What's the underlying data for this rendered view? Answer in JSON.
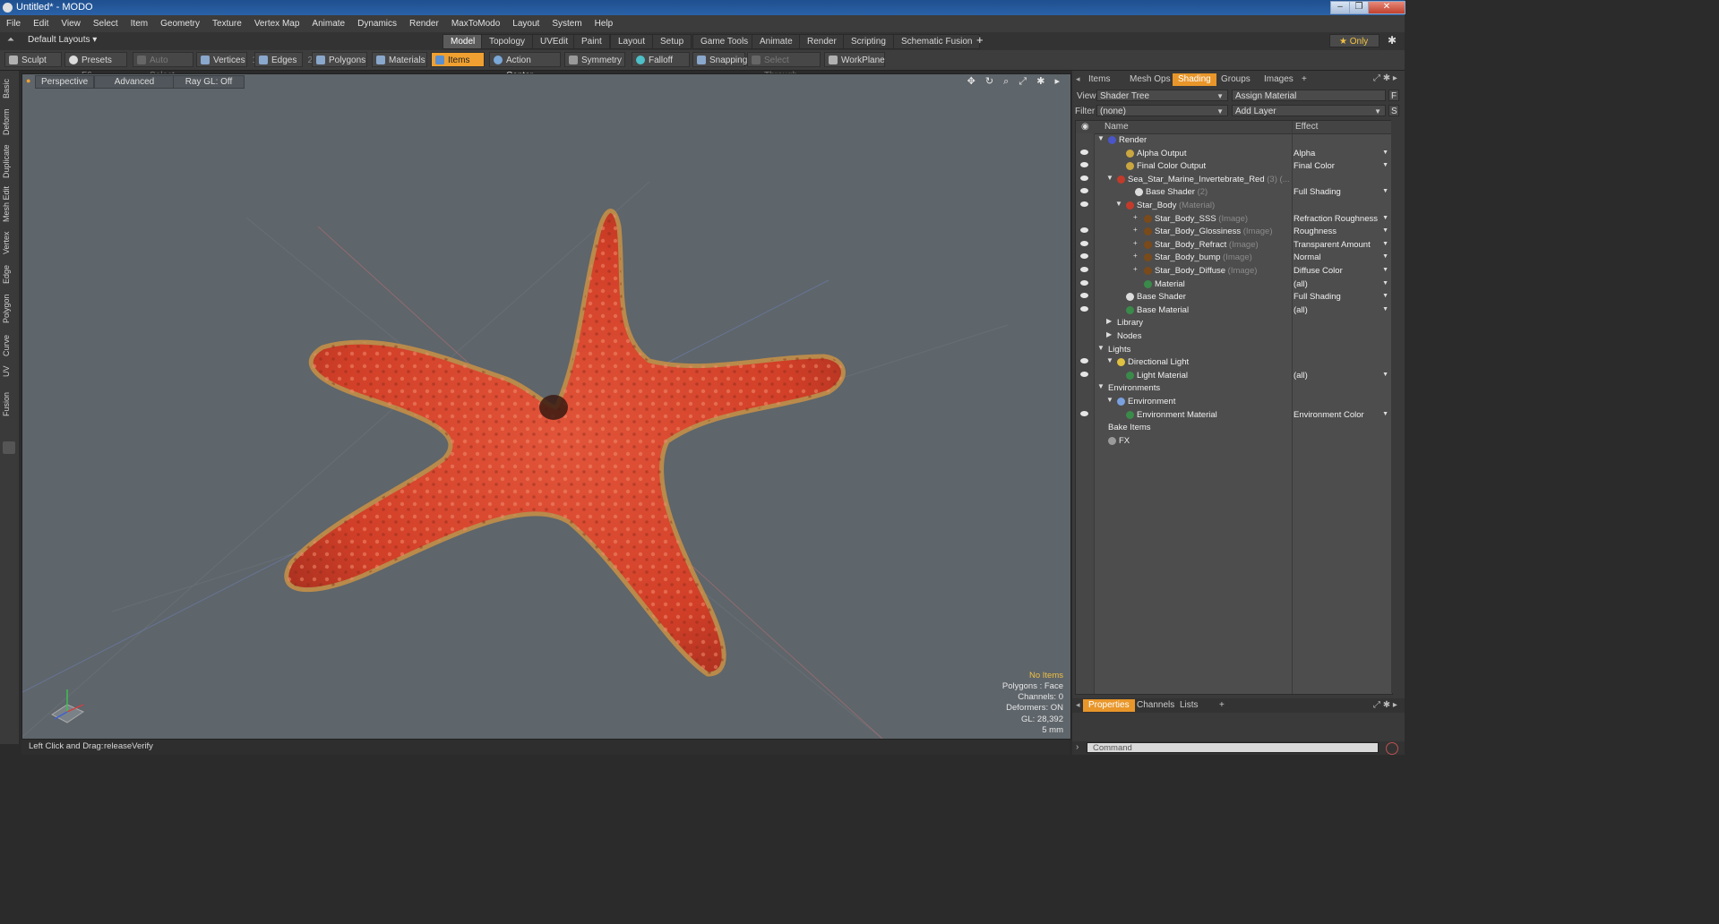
{
  "window": {
    "title": "Untitled* - MODO",
    "minimize": "–",
    "restore": "❐",
    "close": "✕"
  },
  "menu": [
    "File",
    "Edit",
    "View",
    "Select",
    "Item",
    "Geometry",
    "Texture",
    "Vertex Map",
    "Animate",
    "Dynamics",
    "Render",
    "MaxToModo",
    "Layout",
    "System",
    "Help"
  ],
  "layout": {
    "preset": "Default Layouts ▾",
    "tabs": [
      "Model",
      "Topology",
      "UVEdit",
      "Paint",
      "Layout",
      "Setup",
      "Game Tools",
      "Animate",
      "Render",
      "Scripting",
      "Schematic Fusion"
    ],
    "active_tab": "Model",
    "add": "+",
    "only": "★  Only",
    "gear": "✱"
  },
  "toolbar": {
    "sculpt": "Sculpt",
    "presets": "Presets",
    "presets_key": "F6",
    "auto_select": "Auto Select",
    "vertices": "Vertices",
    "vertices_count": "1",
    "edges": "Edges",
    "edges_count": "2",
    "polygons": "Polygons",
    "materials": "Materials",
    "items": "Items",
    "action_center": "Action Center",
    "symmetry": "Symmetry",
    "falloff": "Falloff",
    "snapping": "Snapping",
    "select_through": "Select Through",
    "workplane": "WorkPlane"
  },
  "left_tabs": [
    "Basic",
    "Deform",
    "Duplicate",
    "Mesh Edit",
    "Vertex",
    "Edge",
    "Polygon",
    "Curve",
    "UV",
    "Fusion"
  ],
  "viewport": {
    "perspective": "Perspective",
    "advanced": "Advanced",
    "raygl": "Ray GL: Off",
    "icons": "✥ ↻ ⌕ ⤢ ✱ ▸",
    "stats": {
      "selection": "No Items",
      "polygons": "Polygons : Face",
      "channels": "Channels: 0",
      "deformers": "Deformers: ON",
      "gl": "GL: 28,392",
      "scale": "5 mm"
    }
  },
  "status": {
    "hint": "Left Click and Drag:",
    "action": "releaseVerify"
  },
  "right_panel": {
    "tabs": [
      "Items",
      "Mesh Ops",
      "Shading",
      "Groups",
      "Images"
    ],
    "active_tab": "Shading",
    "add": "+",
    "view_label": "View",
    "view_value": "Shader Tree",
    "assign_material": "Assign Material",
    "f_btn": "F",
    "filter_label": "Filter",
    "filter_value": "(none)",
    "add_layer": "Add Layer",
    "s_btn": "S",
    "col_name": "Name",
    "col_effect": "Effect",
    "tree": [
      {
        "name": "Render",
        "sub": "",
        "effect": "",
        "indent": 0,
        "exp": "▼",
        "eye": false,
        "color": "#4a55c8"
      },
      {
        "name": "Alpha Output",
        "sub": "",
        "effect": "Alpha",
        "indent": 2,
        "exp": "",
        "eye": true,
        "color": "#c9a640"
      },
      {
        "name": "Final Color Output",
        "sub": "",
        "effect": "Final Color",
        "indent": 2,
        "exp": "",
        "eye": true,
        "color": "#c9a640"
      },
      {
        "name": "Sea_Star_Marine_Invertebrate_Red",
        "sub": " (3) (...",
        "effect": "",
        "indent": 1,
        "exp": "▼",
        "eye": true,
        "color": "#c23b2a"
      },
      {
        "name": "Base Shader",
        "sub": " (2)",
        "effect": "Full Shading",
        "indent": 3,
        "exp": "",
        "eye": true,
        "color": "#dcdcdc"
      },
      {
        "name": "Star_Body",
        "sub": " (Material)",
        "effect": "",
        "indent": 2,
        "exp": "▼",
        "eye": true,
        "color": "#c23b2a"
      },
      {
        "name": "Star_Body_SSS",
        "sub": " (Image)",
        "effect": "Refraction Roughness",
        "indent": 4,
        "exp": "+",
        "eye": false,
        "color": "#7a4a1a"
      },
      {
        "name": "Star_Body_Glossiness",
        "sub": " (Image)",
        "effect": "Roughness",
        "indent": 4,
        "exp": "+",
        "eye": true,
        "color": "#7a4a1a"
      },
      {
        "name": "Star_Body_Refract",
        "sub": " (Image)",
        "effect": "Transparent Amount",
        "indent": 4,
        "exp": "+",
        "eye": true,
        "color": "#7a4a1a"
      },
      {
        "name": "Star_Body_bump",
        "sub": " (Image)",
        "effect": "Normal",
        "indent": 4,
        "exp": "+",
        "eye": true,
        "color": "#7a4a1a"
      },
      {
        "name": "Star_Body_Diffuse",
        "sub": " (Image)",
        "effect": "Diffuse Color",
        "indent": 4,
        "exp": "+",
        "eye": true,
        "color": "#7a4a1a"
      },
      {
        "name": "Material",
        "sub": "",
        "effect": "(all)",
        "indent": 4,
        "exp": "",
        "eye": true,
        "color": "#3a8a4a"
      },
      {
        "name": "Base Shader",
        "sub": "",
        "effect": "Full Shading",
        "indent": 2,
        "exp": "",
        "eye": true,
        "color": "#dcdcdc"
      },
      {
        "name": "Base Material",
        "sub": "",
        "effect": "(all)",
        "indent": 2,
        "exp": "",
        "eye": true,
        "color": "#3a8a4a"
      },
      {
        "name": "Library",
        "sub": "",
        "effect": "",
        "indent": 1,
        "exp": "▶",
        "eye": false,
        "color": ""
      },
      {
        "name": "Nodes",
        "sub": "",
        "effect": "",
        "indent": 1,
        "exp": "▶",
        "eye": false,
        "color": ""
      },
      {
        "name": "Lights",
        "sub": "",
        "effect": "",
        "indent": 0,
        "exp": "▼",
        "eye": false,
        "color": ""
      },
      {
        "name": "Directional Light",
        "sub": "",
        "effect": "",
        "indent": 1,
        "exp": "▼",
        "eye": true,
        "color": "#e0c040"
      },
      {
        "name": "Light Material",
        "sub": "",
        "effect": "(all)",
        "indent": 2,
        "exp": "",
        "eye": true,
        "color": "#3a8a4a"
      },
      {
        "name": "Environments",
        "sub": "",
        "effect": "",
        "indent": 0,
        "exp": "▼",
        "eye": false,
        "color": ""
      },
      {
        "name": "Environment",
        "sub": "",
        "effect": "",
        "indent": 1,
        "exp": "▼",
        "eye": false,
        "color": "#7aa0e0"
      },
      {
        "name": "Environment Material",
        "sub": "",
        "effect": "Environment Color",
        "indent": 2,
        "exp": "",
        "eye": true,
        "color": "#3a8a4a"
      },
      {
        "name": "Bake Items",
        "sub": "",
        "effect": "",
        "indent": 0,
        "exp": "",
        "eye": false,
        "color": ""
      },
      {
        "name": "FX",
        "sub": "",
        "effect": "",
        "indent": 0,
        "exp": "",
        "eye": false,
        "color": "#9a9a9a"
      }
    ],
    "bottom_tabs": [
      "Properties",
      "Channels",
      "Lists"
    ],
    "bottom_active": "Properties",
    "command_placeholder": "Command"
  },
  "colors": {
    "accent": "#e8962a",
    "viewport_bg": "#5e656b",
    "starfish": "#d8402a"
  }
}
